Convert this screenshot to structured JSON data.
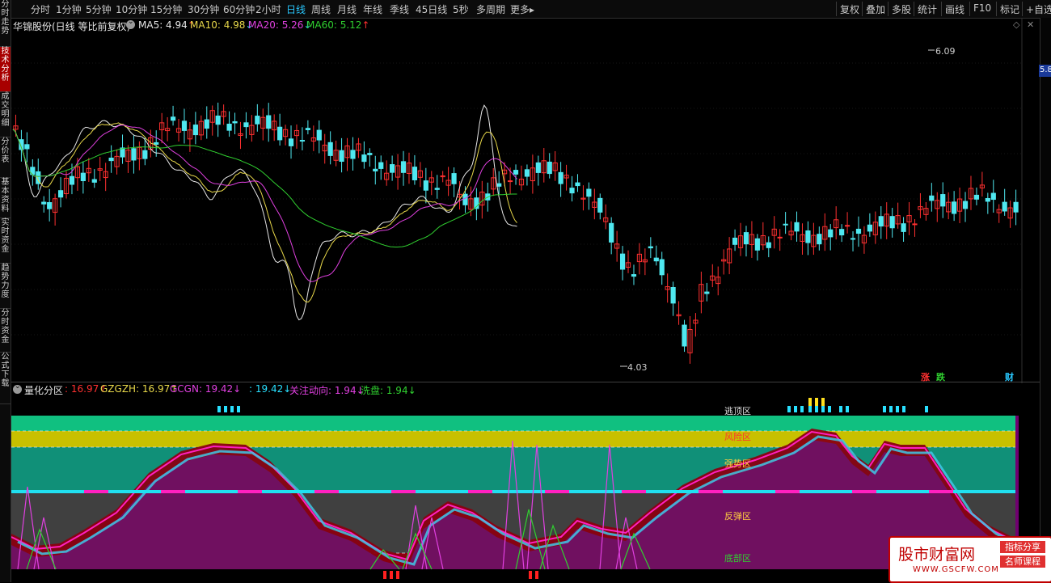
{
  "sidebar": {
    "tabs": [
      {
        "label": "分时走势",
        "active": false
      },
      {
        "label": "技术分析",
        "active": true
      },
      {
        "label": "成交明细",
        "active": false
      },
      {
        "label": "分价表",
        "active": false
      },
      {
        "label": "基本资料",
        "active": false
      },
      {
        "label": "实时资金",
        "active": false
      },
      {
        "label": "趋势力度",
        "active": false
      },
      {
        "label": "分时资金",
        "active": false
      },
      {
        "label": "公式下载",
        "active": false
      }
    ]
  },
  "toolbar": {
    "periods": [
      "分时",
      "1分钟",
      "5分钟",
      "10分钟",
      "15分钟",
      "30分钟",
      "60分钟",
      "2小时",
      "日线",
      "周线",
      "月线",
      "年线",
      "季线",
      "45日线",
      "5秒",
      "多周期",
      "更多▸"
    ],
    "active_period": "日线",
    "right_tools": [
      "复权",
      "叠加",
      "多股",
      "统计",
      "画线",
      "F10",
      "标记",
      "+自选"
    ]
  },
  "main_chart": {
    "stock_title": "华锦股份(日线 等比前复权)",
    "ma": [
      {
        "label": "MA5: 4.94",
        "arrow": "↑",
        "color": "#e6e6e6",
        "arrow_color": "#ff3030"
      },
      {
        "label": "MA10: 4.98",
        "arrow": "↓",
        "color": "#e8d84a",
        "arrow_color": "#29e0ff"
      },
      {
        "label": "MA20: 5.26",
        "arrow": "↓",
        "color": "#e040e0",
        "arrow_color": "#29e0ff"
      },
      {
        "label": "MA60: 5.12",
        "arrow": "↑",
        "color": "#30d030",
        "arrow_color": "#ff3030"
      }
    ],
    "high_label": "6.09",
    "low_label": "4.03",
    "right_price_tag": "5.8",
    "badges": [
      {
        "text": "涨",
        "color": "#ff3030"
      },
      {
        "text": "跌",
        "color": "#30d030"
      },
      {
        "text": "财",
        "color": "#29c8ff"
      }
    ]
  },
  "indicator": {
    "name": "量化分区",
    "values": [
      {
        "label": ": 16.97",
        "arrow": "↑",
        "color": "#ff3030"
      },
      {
        "label": "GZGZH: 16.97",
        "arrow": "↑",
        "color": "#e8d84a"
      },
      {
        "label": "GCGN: 19.42",
        "arrow": "↓",
        "color": "#e040e0"
      },
      {
        "label": ": 19.42",
        "arrow": "↓",
        "color": "#29e0ff"
      },
      {
        "label": "关注动向: 1.94",
        "arrow": "↓",
        "color": "#e040e0"
      },
      {
        "label": "洗盘: 1.94",
        "arrow": "↓",
        "color": "#30d030"
      }
    ],
    "zones": [
      {
        "label": "逃顶区",
        "color": "#e0e0e0"
      },
      {
        "label": "风险区",
        "color": "#ff3030"
      },
      {
        "label": "强势区",
        "color": "#ffd040"
      },
      {
        "label": "反弹区",
        "color": "#ffd040"
      },
      {
        "label": "底部区",
        "color": "#30d030"
      }
    ]
  },
  "watermark": {
    "title": "股市财富网",
    "tag1": "指标分享",
    "tag2": "名师课程",
    "url": "WWW.GSCFW.COM"
  },
  "colors": {
    "up": "#ff3030",
    "down": "#4fe8f0",
    "ma5": "#e6e6e6",
    "ma10": "#e8d84a",
    "ma20": "#e040e0",
    "ma60": "#30d030"
  }
}
